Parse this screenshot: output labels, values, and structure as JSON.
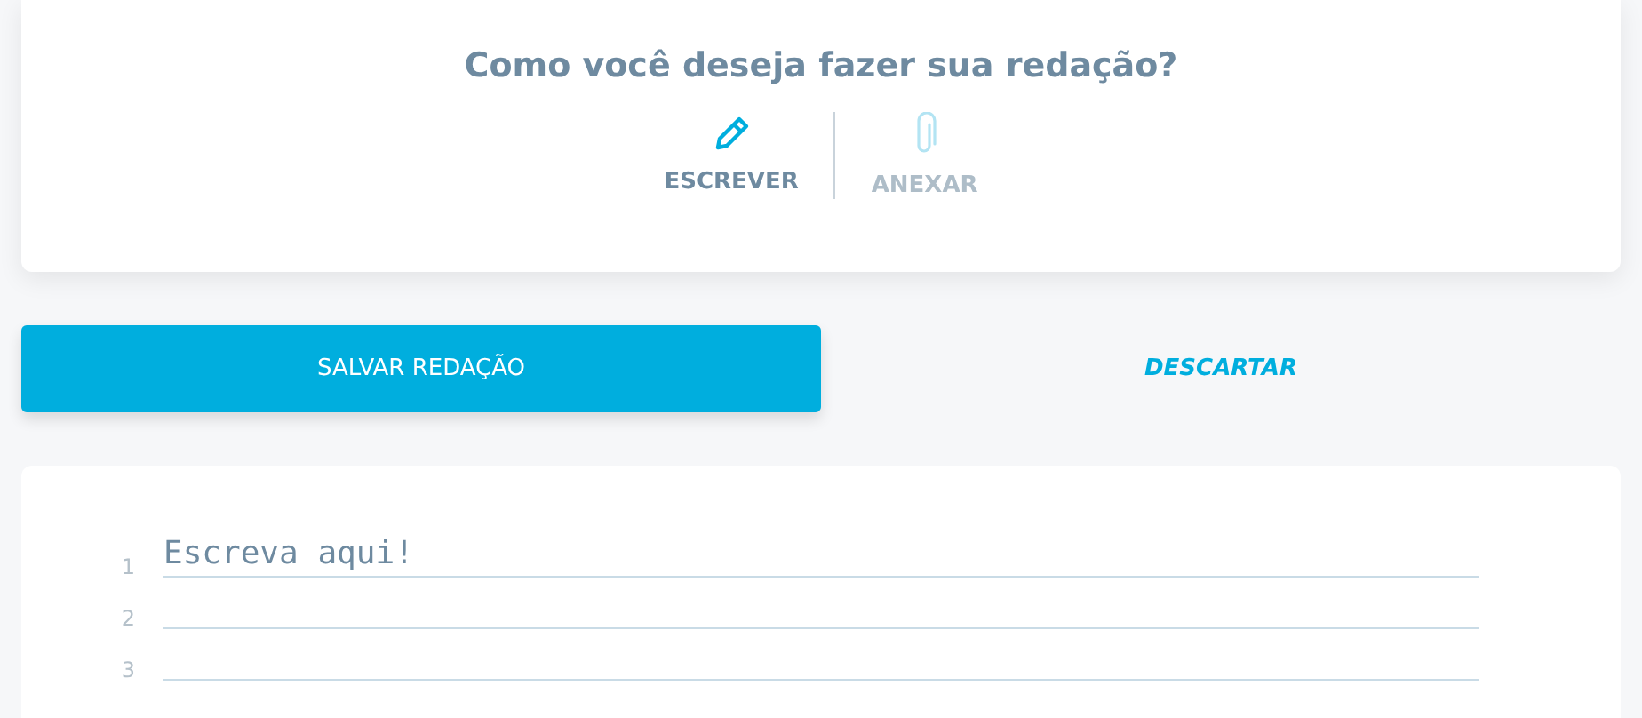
{
  "mode_card": {
    "title": "Como você deseja fazer sua redação?",
    "options": [
      {
        "label": "ESCREVER",
        "kind": "pencil",
        "selected": true
      },
      {
        "label": "ANEXAR",
        "kind": "clip",
        "selected": false
      }
    ]
  },
  "actions": {
    "save": "SALVAR REDAÇÃO",
    "discard": "DESCARTAR"
  },
  "editor": {
    "lines": [
      {
        "number": "1",
        "placeholder": "Escreva aqui!"
      },
      {
        "number": "2"
      },
      {
        "number": "3"
      }
    ]
  }
}
